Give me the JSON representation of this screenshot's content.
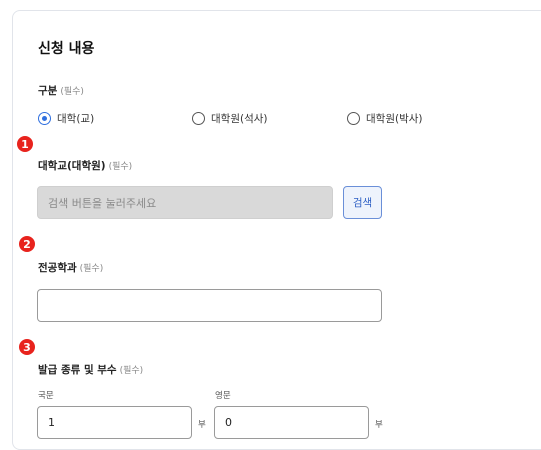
{
  "section": {
    "title": "신청 내용"
  },
  "category": {
    "label": "구분",
    "required": "(필수)",
    "options": [
      {
        "label": "대학(교)",
        "selected": true
      },
      {
        "label": "대학원(석사)",
        "selected": false
      },
      {
        "label": "대학원(박사)",
        "selected": false
      }
    ]
  },
  "university": {
    "step": "1",
    "label": "대학교(대학원)",
    "required": "(필수)",
    "placeholder": "검색 버튼을 눌러주세요",
    "search_button": "검색"
  },
  "major": {
    "step": "2",
    "label": "전공학과",
    "required": "(필수)",
    "value": ""
  },
  "issuance": {
    "step": "3",
    "label": "발급 종류 및 부수",
    "required": "(필수)",
    "korean": {
      "label": "국문",
      "value": "1",
      "unit": "부"
    },
    "english": {
      "label": "영문",
      "value": "0",
      "unit": "부"
    }
  },
  "colors": {
    "accent": "#2f6fdf",
    "step_badge": "#e8231d",
    "disabled_bg": "#d9d9d9"
  }
}
